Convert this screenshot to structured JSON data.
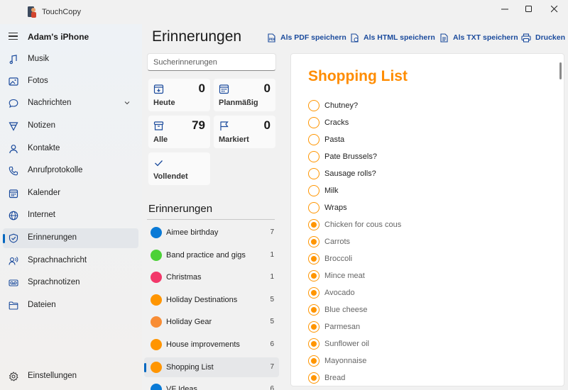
{
  "app": {
    "title": "TouchCopy",
    "device": "Adam's iPhone"
  },
  "sidebar": {
    "items": [
      {
        "label": "Musik",
        "icon": "music-icon"
      },
      {
        "label": "Fotos",
        "icon": "photos-icon"
      },
      {
        "label": "Nachrichten",
        "icon": "messages-icon"
      },
      {
        "label": "Notizen",
        "icon": "notes-icon"
      },
      {
        "label": "Kontakte",
        "icon": "contacts-icon"
      },
      {
        "label": "Anrufprotokolle",
        "icon": "phone-icon"
      },
      {
        "label": "Kalender",
        "icon": "calendar-icon"
      },
      {
        "label": "Internet",
        "icon": "globe-icon"
      },
      {
        "label": "Erinnerungen",
        "icon": "reminders-icon",
        "active": true
      },
      {
        "label": "Sprachnachricht",
        "icon": "voicemail-icon"
      },
      {
        "label": "Sprachnotizen",
        "icon": "voice-memo-icon"
      },
      {
        "label": "Dateien",
        "icon": "folder-icon"
      }
    ],
    "settings": "Einstellungen"
  },
  "header": {
    "title": "Erinnerungen",
    "actions": {
      "pdf": "Als PDF speichern",
      "html": "Als HTML speichern",
      "txt": "Als TXT speichern",
      "print": "Drucken"
    }
  },
  "search": {
    "placeholder": "Sucherinnerungen"
  },
  "smart_lists": {
    "today": {
      "label": "Heute",
      "count": "0"
    },
    "scheduled": {
      "label": "Planmäßig",
      "count": "0"
    },
    "all": {
      "label": "Alle",
      "count": "79"
    },
    "flagged": {
      "label": "Markiert",
      "count": "0"
    },
    "completed": {
      "label": "Vollendet"
    }
  },
  "lists_title": "Erinnerungen",
  "lists": [
    {
      "name": "Aimee birthday",
      "count": "7",
      "color": "#0a7ad6"
    },
    {
      "name": "Band practice and gigs",
      "count": "1",
      "color": "#4cd137"
    },
    {
      "name": "Christmas",
      "count": "1",
      "color": "#f2386a"
    },
    {
      "name": "Holiday Destinations",
      "count": "5",
      "color": "#ff9500"
    },
    {
      "name": "Holiday Gear",
      "count": "5",
      "color": "#f88d35"
    },
    {
      "name": "House improvements",
      "count": "6",
      "color": "#ff9500"
    },
    {
      "name": "Shopping List",
      "count": "7",
      "color": "#ff9500",
      "active": true
    },
    {
      "name": "VF Ideas",
      "count": "6",
      "color": "#0a7ad6"
    }
  ],
  "detail": {
    "title": "Shopping List",
    "accent": "#ff9500",
    "items": [
      {
        "text": "Chutney?",
        "done": false
      },
      {
        "text": "Cracks",
        "done": false
      },
      {
        "text": "Pasta",
        "done": false
      },
      {
        "text": "Pate Brussels?",
        "done": false
      },
      {
        "text": "Sausage rolls?",
        "done": false
      },
      {
        "text": "Milk",
        "done": false
      },
      {
        "text": "Wraps",
        "done": false
      },
      {
        "text": "Chicken for cous cous",
        "done": true
      },
      {
        "text": "Carrots",
        "done": true
      },
      {
        "text": "Broccoli",
        "done": true
      },
      {
        "text": "Mince meat",
        "done": true
      },
      {
        "text": "Avocado",
        "done": true
      },
      {
        "text": "Blue cheese",
        "done": true
      },
      {
        "text": "Parmesan",
        "done": true
      },
      {
        "text": "Sunflower oil",
        "done": true
      },
      {
        "text": "Mayonnaise",
        "done": true
      },
      {
        "text": "Bread",
        "done": true
      }
    ]
  }
}
